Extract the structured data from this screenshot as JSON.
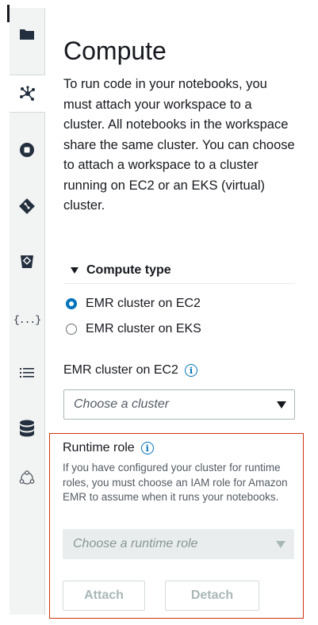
{
  "rail": {
    "items": [
      {
        "icon": "folder-icon"
      },
      {
        "icon": "compute-cluster-icon"
      },
      {
        "icon": "stop-circle-icon"
      },
      {
        "icon": "git-icon"
      },
      {
        "icon": "trash-icon"
      },
      {
        "icon": "json-braces-icon",
        "text": "{...}"
      },
      {
        "icon": "list-icon"
      },
      {
        "icon": "database-icon"
      },
      {
        "icon": "collaboration-icon"
      }
    ]
  },
  "compute": {
    "title": "Compute",
    "description": "To run code in your notebooks, you must attach your workspace to a cluster. All notebooks in the workspace share the same cluster. You can choose to attach a workspace to a cluster running on EC2 or an EKS (virtual) cluster.",
    "section_label": "Compute type",
    "options": [
      {
        "label": "EMR cluster on EC2",
        "checked": true
      },
      {
        "label": "EMR cluster on EKS",
        "checked": false
      }
    ],
    "cluster_field_label": "EMR cluster on EC2",
    "info_glyph": "i",
    "cluster_placeholder": "Choose a cluster"
  },
  "runtime_role": {
    "title": "Runtime role",
    "description": "If you have configured your cluster for runtime roles, you must choose an IAM role for Amazon EMR to assume when it runs your notebooks.",
    "placeholder": "Choose a runtime role"
  },
  "buttons": {
    "attach": "Attach",
    "detach": "Detach"
  },
  "colors": {
    "accent": "#0073bb",
    "highlight_border": "#d13212",
    "disabled_text": "#aab7b8"
  }
}
